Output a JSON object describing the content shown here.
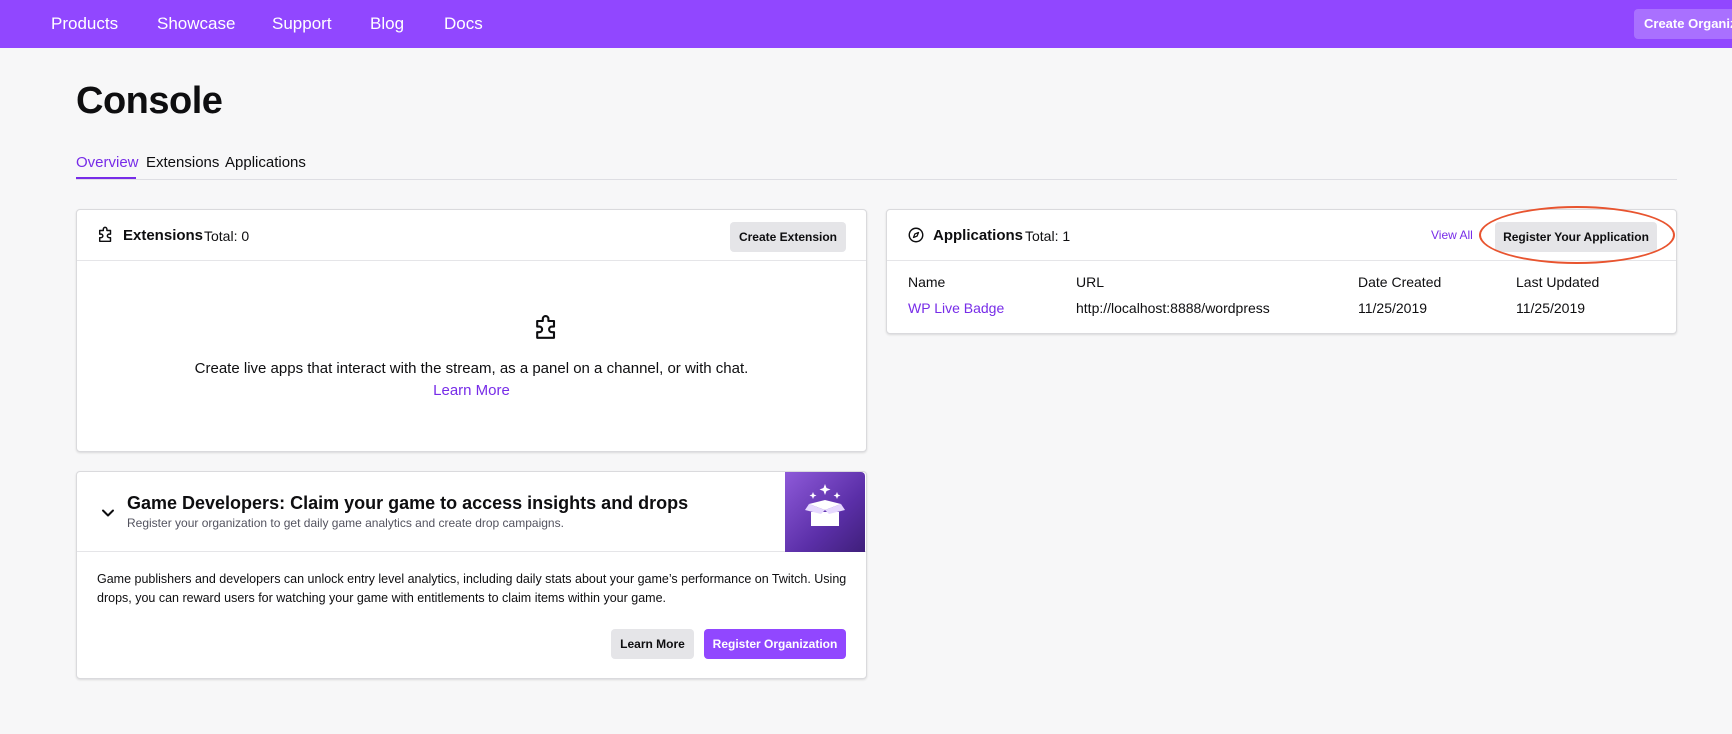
{
  "nav": {
    "links": [
      "Products",
      "Showcase",
      "Support",
      "Blog",
      "Docs"
    ],
    "create_org": "Create Organization"
  },
  "page": {
    "title": "Console",
    "tabs": [
      "Overview",
      "Extensions",
      "Applications"
    ],
    "active_tab": "Overview"
  },
  "extensions_card": {
    "title": "Extensions",
    "total": "Total: 0",
    "create_button": "Create Extension",
    "empty_text": "Create live apps that interact with the stream, as a panel on a channel, or with chat.",
    "learn_more": "Learn More",
    "icon": "puzzle-icon"
  },
  "applications_card": {
    "title": "Applications",
    "total": "Total: 1",
    "view_all": "View All",
    "register_button": "Register Your Application",
    "icon": "compass-icon",
    "columns": [
      "Name",
      "URL",
      "Date Created",
      "Last Updated"
    ],
    "rows": [
      {
        "name": "WP Live Badge",
        "url": "http://localhost:8888/wordpress",
        "date_created": "11/25/2019",
        "last_updated": "11/25/2019"
      }
    ]
  },
  "game_dev_card": {
    "title": "Game Developers: Claim your game to access insights and drops",
    "subtitle": "Register your organization to get daily game analytics and create drop campaigns.",
    "body": "Game publishers and developers can unlock entry level analytics, including daily stats about your game’s performance on Twitch. Using drops, you can reward users for watching your game with entitlements to claim items within your game.",
    "learn_more": "Learn More",
    "register_org": "Register Organization",
    "icon": "gift-box-icon"
  },
  "colors": {
    "brand": "#9147ff",
    "link": "#772ce8",
    "annotation": "#e8542f"
  }
}
